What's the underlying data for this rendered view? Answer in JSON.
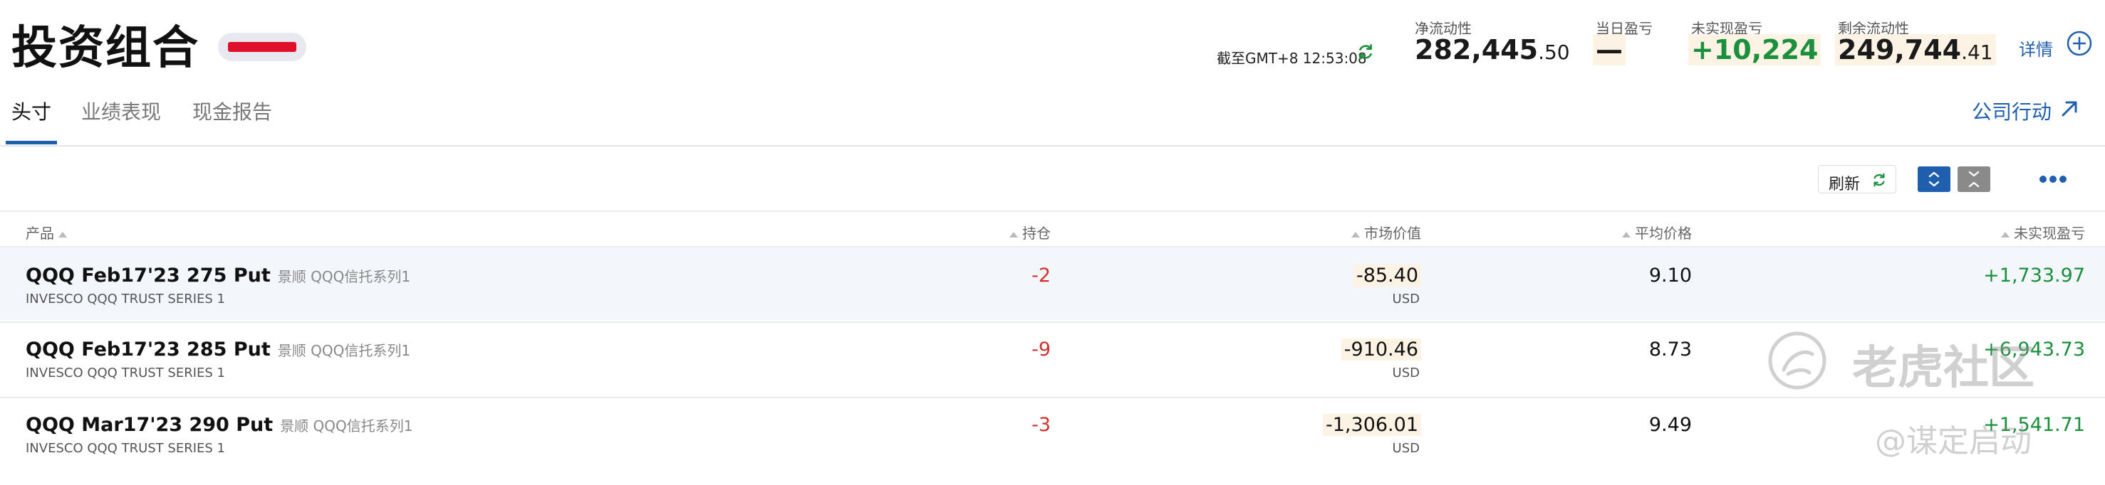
{
  "header": {
    "title": "投资组合",
    "as_of": "截至GMT+8 12:53:08",
    "details_label": "详情"
  },
  "metrics": [
    {
      "label": "净流动性",
      "value_int": "282,445",
      "value_dec": ".50",
      "color": "#1a1a1a"
    },
    {
      "label": "当日盈亏",
      "value_int": "—",
      "value_dec": "",
      "color": "#1a1a1a"
    },
    {
      "label": "未实现盈亏",
      "value_int": "+10,224",
      "value_dec": "",
      "color": "#1a8f3c"
    },
    {
      "label": "剩余流动性",
      "value_int": "249,744",
      "value_dec": ".41",
      "color": "#1a1a1a"
    }
  ],
  "tabs": [
    {
      "label": "头寸",
      "active": true
    },
    {
      "label": "业绩表现",
      "active": false
    },
    {
      "label": "现金报告",
      "active": false
    }
  ],
  "corporate_action_label": "公司行动",
  "toolbar": {
    "refresh_label": "刷新"
  },
  "table": {
    "columns": {
      "product": "产品",
      "position": "持仓",
      "market_value": "市场价值",
      "avg_price": "平均价格",
      "unrealized_pnl": "未实现盈亏"
    },
    "rows": [
      {
        "name": "QQQ Feb17'23 275 Put",
        "alias": "景顺 QQQ信托系列1",
        "desc": "INVESCO QQQ TRUST SERIES 1",
        "position": "-2",
        "market_value": "-85.40",
        "currency": "USD",
        "avg_price": "9.10",
        "unrealized_pnl": "+1,733.97"
      },
      {
        "name": "QQQ Feb17'23 285 Put",
        "alias": "景顺 QQQ信托系列1",
        "desc": "INVESCO QQQ TRUST SERIES 1",
        "position": "-9",
        "market_value": "-910.46",
        "currency": "USD",
        "avg_price": "8.73",
        "unrealized_pnl": "+6,943.73"
      },
      {
        "name": "QQQ Mar17'23 290 Put",
        "alias": "景顺 QQQ信托系列1",
        "desc": "INVESCO QQQ TRUST SERIES 1",
        "position": "-3",
        "market_value": "-1,306.01",
        "currency": "USD",
        "avg_price": "9.49",
        "unrealized_pnl": "+1,541.71"
      }
    ]
  },
  "watermark": {
    "text": "老虎社区",
    "handle": "@谋定启动"
  },
  "colors": {
    "accent": "#1f5fae",
    "positive": "#1a8f3c",
    "negative": "#d0312d"
  }
}
